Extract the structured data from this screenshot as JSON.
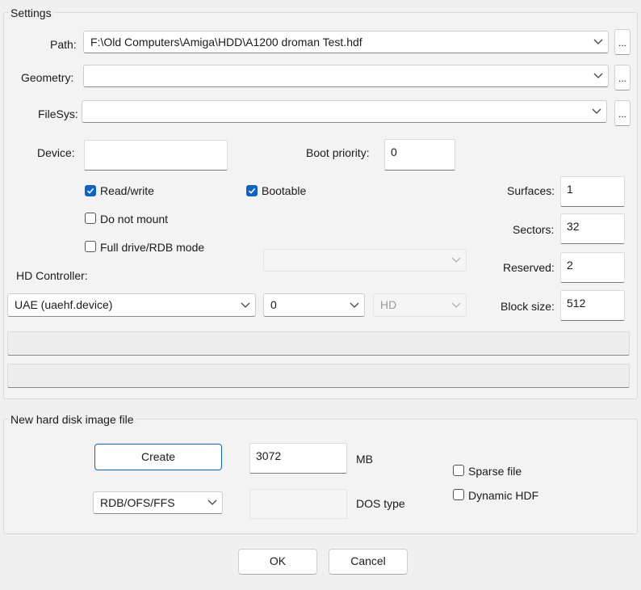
{
  "settings": {
    "title": "Settings",
    "path": {
      "label": "Path:",
      "value": "F:\\Old Computers\\Amiga\\HDD\\A1200 droman Test.hdf",
      "browse": "..."
    },
    "geometry": {
      "label": "Geometry:",
      "value": "",
      "browse": "..."
    },
    "filesys": {
      "label": "FileSys:",
      "value": "",
      "browse": "..."
    },
    "device": {
      "label": "Device:",
      "value": ""
    },
    "boot_priority": {
      "label": "Boot priority:",
      "value": "0"
    },
    "checkboxes": {
      "read_write": {
        "label": "Read/write",
        "checked": true
      },
      "bootable": {
        "label": "Bootable",
        "checked": true
      },
      "do_not_mount": {
        "label": "Do not mount",
        "checked": false
      },
      "full_drive": {
        "label": "Full drive/RDB mode",
        "checked": false
      }
    },
    "surfaces": {
      "label": "Surfaces:",
      "value": "1"
    },
    "sectors": {
      "label": "Sectors:",
      "value": "32"
    },
    "reserved": {
      "label": "Reserved:",
      "value": "2"
    },
    "block_size": {
      "label": "Block size:",
      "value": "512"
    },
    "hd_controller": {
      "label": "HD Controller:",
      "controller": "UAE (uaehf.device)",
      "unit": "0",
      "type": "HD",
      "extra": ""
    }
  },
  "new_image": {
    "title": "New hard disk image file",
    "create_label": "Create",
    "size_value": "3072",
    "size_unit": "MB",
    "format": "RDB/OFS/FFS",
    "dos_type_value": "",
    "dos_type_label": "DOS type",
    "sparse": {
      "label": "Sparse file",
      "checked": false
    },
    "dynamic": {
      "label": "Dynamic HDF",
      "checked": false
    }
  },
  "footer": {
    "ok_label": "OK",
    "cancel_label": "Cancel"
  },
  "colors": {
    "accent": "#0f63c9",
    "background": "#f0f0f0"
  }
}
